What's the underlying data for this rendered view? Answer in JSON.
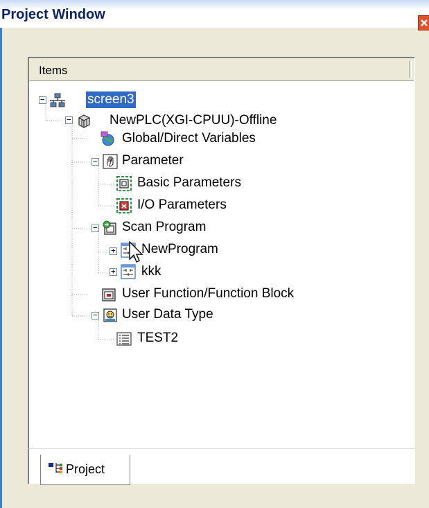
{
  "window": {
    "title": "Project Window"
  },
  "panel": {
    "column_header": "Items"
  },
  "tree": {
    "root": "screen3",
    "plc": "NewPLC(XGI-CPUU)-Offline",
    "global_vars": "Global/Direct Variables",
    "parameter": "Parameter",
    "basic_params": "Basic Parameters",
    "io_params": "I/O Parameters",
    "scan_program": "Scan Program",
    "new_program": "NewProgram",
    "kkk": "kkk",
    "user_function": "User Function/Function Block",
    "user_data_type": "User Data Type",
    "test2": "TEST2"
  },
  "tabs": {
    "project": "Project"
  },
  "colors": {
    "selection": "#316ac5",
    "title_text": "#0a246a",
    "close_button": "#e0502a",
    "window_bg": "#ece9d8"
  },
  "icons": {
    "root": "network-icon",
    "plc": "plc-cube-icon",
    "global_vars": "globe-variables-icon",
    "parameter": "hand-parameter-icon",
    "basic_params": "basic-parameter-icon",
    "io_params": "io-parameter-icon",
    "scan_program": "scan-program-icon",
    "program": "program-icon",
    "user_function": "function-block-icon",
    "user_data_type": "data-type-icon",
    "test2": "list-icon",
    "tab": "project-tab-icon"
  }
}
